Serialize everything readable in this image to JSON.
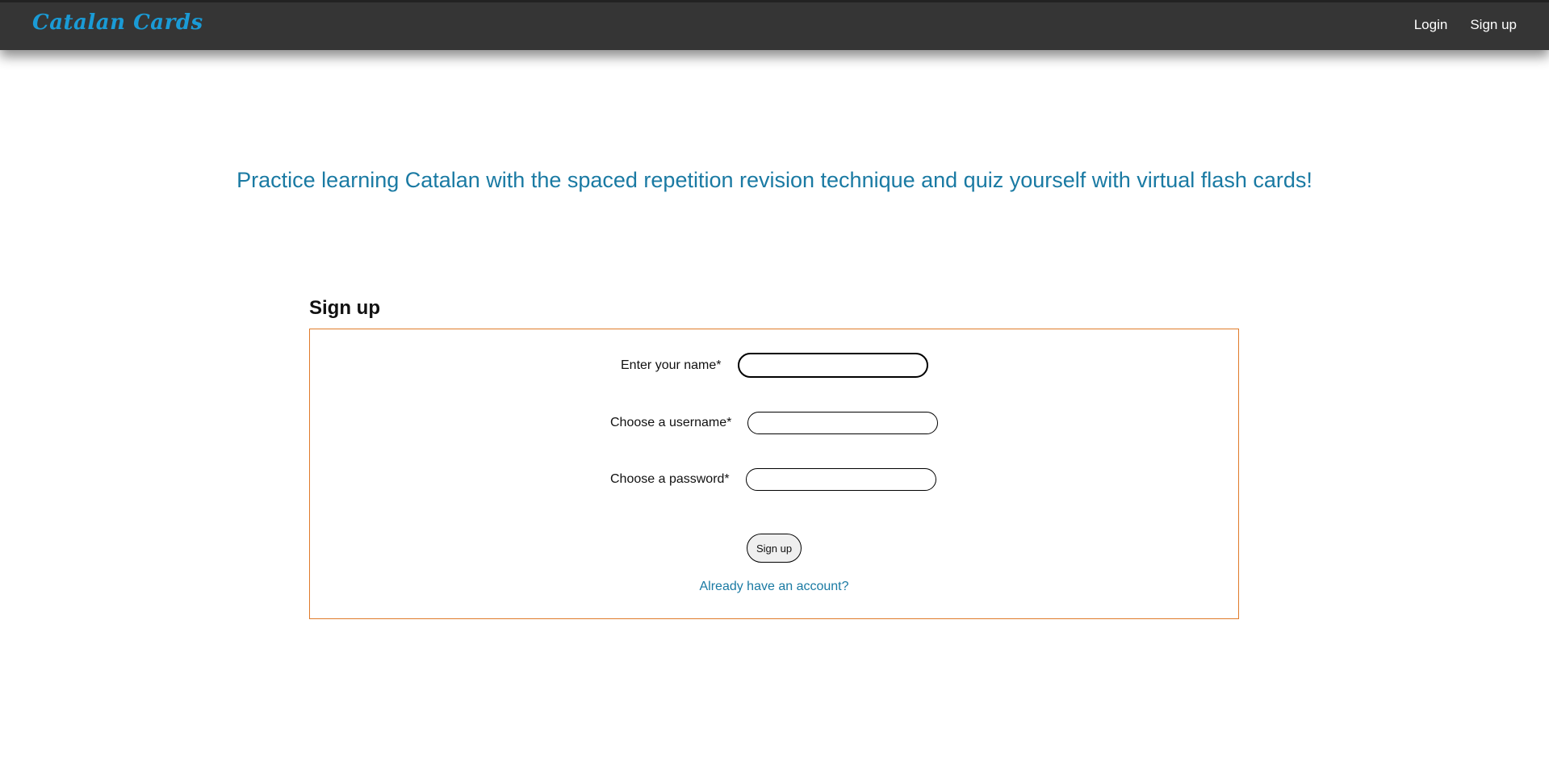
{
  "navbar": {
    "brand": "Catalan Cards",
    "links": [
      {
        "label": "Login"
      },
      {
        "label": "Sign up"
      }
    ]
  },
  "hero": {
    "tagline": "Practice learning Catalan with the spaced repetition revision technique and quiz yourself with virtual flash cards!"
  },
  "signup_form": {
    "title": "Sign up",
    "fields": [
      {
        "label": "Enter your name*",
        "value": ""
      },
      {
        "label": "Choose a username*",
        "value": ""
      },
      {
        "label": "Choose a password*",
        "value": ""
      }
    ],
    "submit_label": "Sign up",
    "login_link": "Already have an account?"
  },
  "colors": {
    "brand": "#1a9bd6",
    "accent_text": "#1a7aa3",
    "form_border": "#e07b2a",
    "navbar_bg": "#353535"
  }
}
